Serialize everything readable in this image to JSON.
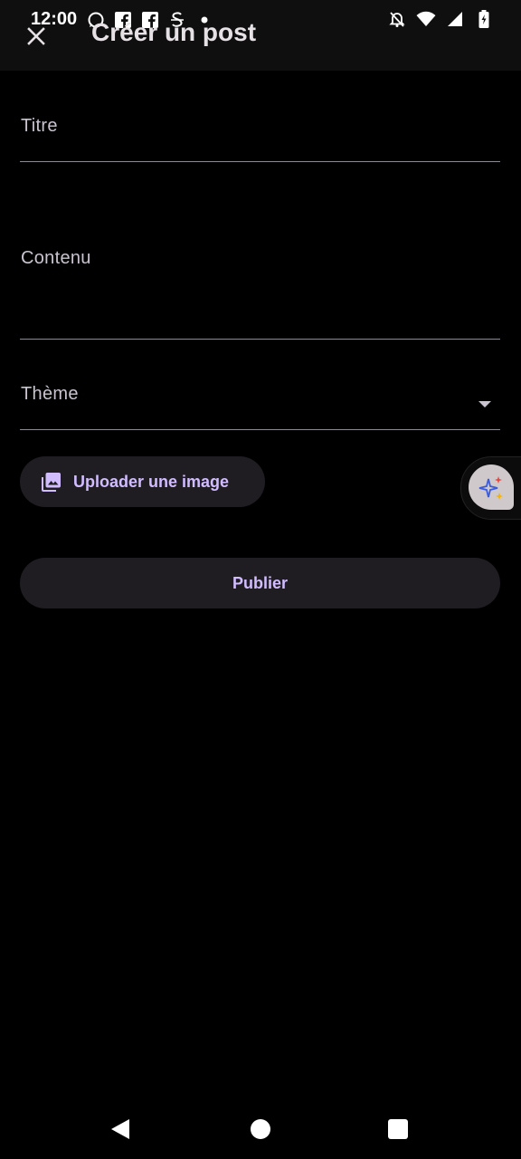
{
  "status_bar": {
    "time": "12:00",
    "notification_icons": [
      "whatsapp-icon",
      "facebook-icon",
      "facebook-icon",
      "s-app-icon",
      "dot-icon"
    ],
    "system_icons": [
      "silent-bell-icon",
      "wifi-icon",
      "signal-icon",
      "battery-icon"
    ]
  },
  "app_bar": {
    "title": "Créer un post",
    "close_icon": "close-icon"
  },
  "form": {
    "title_label": "Titre",
    "content_label": "Contenu",
    "theme_label": "Thème"
  },
  "actions": {
    "upload_label": "Uploader une image",
    "upload_icon": "image-icon",
    "publish_label": "Publier"
  },
  "colors": {
    "background": "#000000",
    "surface": "#1f1d22",
    "accent": "#d0bcff",
    "label": "#cac4d0"
  }
}
